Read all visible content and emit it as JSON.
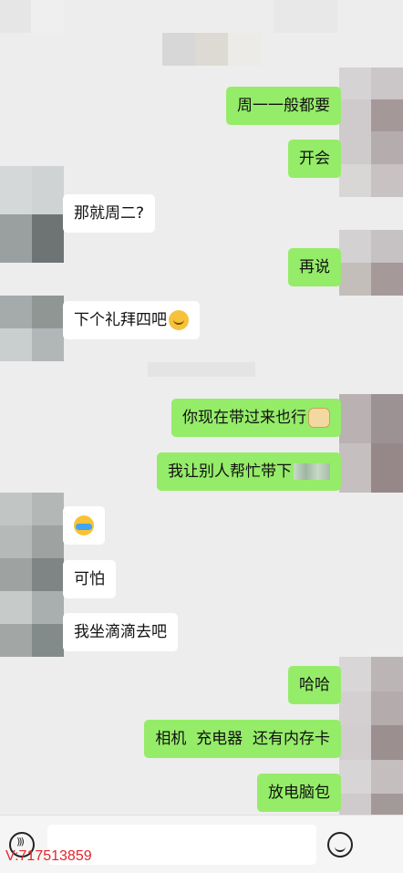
{
  "messages": [
    {
      "side": "me",
      "text": "周一一般都要"
    },
    {
      "side": "me",
      "text": "开会"
    },
    {
      "side": "other",
      "text": "那就周二?"
    },
    {
      "side": "me",
      "text": "再说"
    },
    {
      "side": "other",
      "text": "下个礼拜四吧",
      "emoji": "thinking-emoji"
    },
    {
      "side": "me",
      "text": "你现在带过来也行",
      "emoji": "doge-emoji"
    },
    {
      "side": "me",
      "text": "我让别人帮忙带下",
      "emoji": "blurred-image"
    },
    {
      "side": "other",
      "text": "",
      "emoji": "crying-laughing-emoji"
    },
    {
      "side": "other",
      "text": "可怕"
    },
    {
      "side": "other",
      "text": "我坐滴滴去吧"
    },
    {
      "side": "me",
      "text": "哈哈"
    },
    {
      "side": "me",
      "text": "相机  充电器  还有内存卡"
    },
    {
      "side": "me",
      "text": "放电脑包"
    }
  ],
  "input_bar": {
    "voice_icon": "voice-icon",
    "emoji_icon": "emoji-icon"
  },
  "watermark": "V:717513859",
  "colors": {
    "me_bubble": "#95ec69",
    "other_bubble": "#ffffff",
    "background": "#ededed",
    "watermark": "#e8232b"
  }
}
